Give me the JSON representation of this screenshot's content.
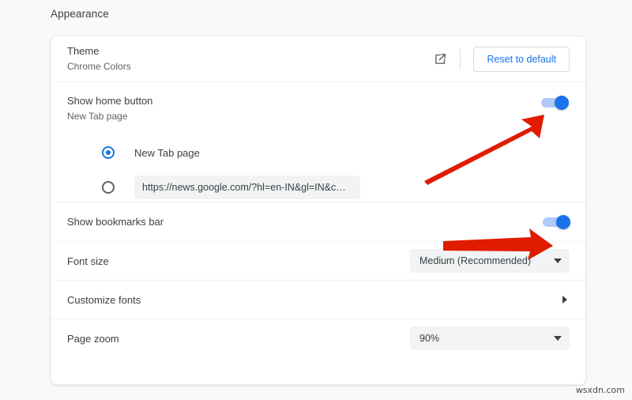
{
  "section": {
    "title": "Appearance"
  },
  "rows": {
    "theme": {
      "label": "Theme",
      "sublabel": "Chrome Colors",
      "open_icon": "external-link-icon",
      "reset_label": "Reset to default"
    },
    "home_button": {
      "label": "Show home button",
      "sublabel": "New Tab page",
      "toggle_state": "on",
      "options": [
        {
          "label": "New Tab page",
          "selected": true
        },
        {
          "value": "https://news.google.com/?hl=en-IN&gl=IN&c…",
          "selected": false
        }
      ]
    },
    "bookmarks_bar": {
      "label": "Show bookmarks bar",
      "toggle_state": "on"
    },
    "font_size": {
      "label": "Font size",
      "value": "Medium (Recommended)",
      "icon": "chevron-down-icon"
    },
    "customize_fonts": {
      "label": "Customize fonts",
      "icon": "chevron-right-icon"
    },
    "page_zoom": {
      "label": "Page zoom",
      "value": "90%",
      "icon": "chevron-down-icon"
    }
  },
  "annotations": {
    "arrow_color": "#e01b00",
    "arrow_home_toggle": "arrow-pointing-to-home-button-toggle",
    "arrow_bookmarks_toggle": "arrow-pointing-to-bookmarks-bar-toggle"
  },
  "watermark": {
    "text": "wsxdn.com"
  },
  "colors": {
    "accent": "#1a73e8",
    "toggle_track": "#aecbfa",
    "page_background": "#f8f9fa",
    "card_background": "#ffffff",
    "field_background": "#f1f3f4",
    "text_primary": "#3c4043",
    "text_secondary": "#5f6368"
  }
}
